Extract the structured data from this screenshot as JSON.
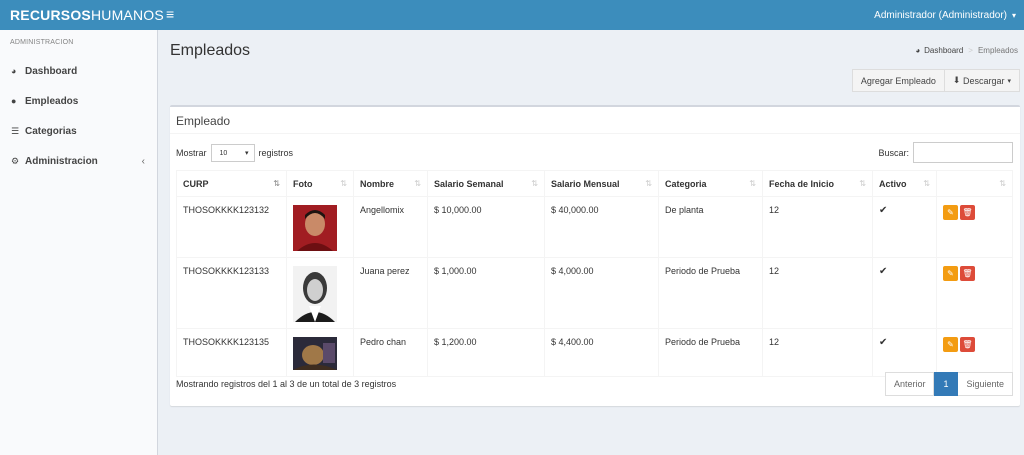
{
  "header": {
    "brand_bold": "RECURSOS",
    "brand_light": "HUMANOS",
    "menu_icon": "hamburger-icon",
    "user_label": "Administrador (Administrador)",
    "colors": {
      "primary": "#3c8dbc"
    }
  },
  "sidebar": {
    "section": "ADMINISTRACION",
    "items": [
      {
        "label": "Dashboard",
        "icon": "dashboard-icon"
      },
      {
        "label": "Empleados",
        "icon": "user-icon"
      },
      {
        "label": "Categorias",
        "icon": "list-icon"
      },
      {
        "label": "Administracion",
        "icon": "gear-icon"
      }
    ]
  },
  "page": {
    "title": "Empleados",
    "breadcrumb": [
      "Dashboard",
      "Empleados"
    ],
    "actions": {
      "add": "Agregar Empleado",
      "download": "Descargar"
    }
  },
  "box": {
    "title": "Empleado",
    "length_prefix": "Mostrar",
    "length_value": "10",
    "length_suffix": "registros",
    "search_label": "Buscar:",
    "columns": [
      "CURP",
      "Foto",
      "Nombre",
      "Salario Semanal",
      "Salario Mensual",
      "Categoria",
      "Fecha de Inicio",
      "Activo",
      ""
    ],
    "rows": [
      {
        "curp": "THOSOKKKK123132",
        "nombre": "Angellomix",
        "semanal": "$ 10,000.00",
        "mensual": "$ 40,000.00",
        "categoria": "De planta",
        "fecha": "12"
      },
      {
        "curp": "THOSOKKKK123133",
        "nombre": "Juana perez",
        "semanal": "$ 1,000.00",
        "mensual": "$ 4,000.00",
        "categoria": "Periodo de Prueba",
        "fecha": "12"
      },
      {
        "curp": "THOSOKKKK123135",
        "nombre": "Pedro chan",
        "semanal": "$ 1,200.00",
        "mensual": "$ 4,400.00",
        "categoria": "Periodo de Prueba",
        "fecha": "12"
      }
    ],
    "info": "Mostrando registros del 1 al 3 de un total de 3 registros",
    "pagination": {
      "prev": "Anterior",
      "current": "1",
      "next": "Siguiente"
    }
  }
}
